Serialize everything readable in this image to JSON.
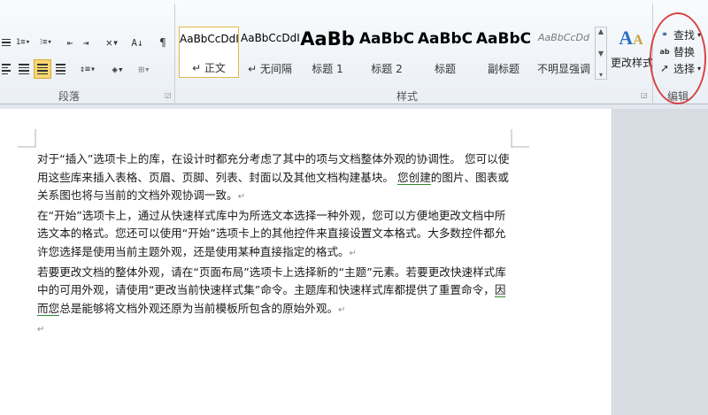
{
  "paragraph_group": {
    "label": "段落",
    "icons": [
      "bullets-icon",
      "numbering-icon",
      "multilevel-list-icon",
      "decrease-indent-icon",
      "increase-indent-icon",
      "chinese-layout-icon",
      "sort-icon",
      "show-marks-icon",
      "align-left-icon",
      "align-center-icon",
      "justify-icon",
      "distributed-icon",
      "line-spacing-icon",
      "shading-icon",
      "borders-icon"
    ]
  },
  "styles_group": {
    "label": "样式",
    "gallery": [
      {
        "sample": "AaBbCcDdI",
        "name": "↵ 正文",
        "selected": true
      },
      {
        "sample": "AaBbCcDdI",
        "name": "↵ 无间隔",
        "selected": false
      },
      {
        "sample": "AaBb",
        "name": "标题 1",
        "selected": false
      },
      {
        "sample": "AaBbC",
        "name": "标题 2",
        "selected": false
      },
      {
        "sample": "AaBbC",
        "name": "标题",
        "selected": false
      },
      {
        "sample": "AaBbC",
        "name": "副标题",
        "selected": false
      },
      {
        "sample": "AaBbCcDd",
        "name": "不明显强调",
        "selected": false
      }
    ],
    "change_styles_label": "更改样式"
  },
  "editing_group": {
    "label": "编辑",
    "find_label": "查找",
    "replace_label": "替换",
    "select_label": "选择"
  },
  "document": {
    "para1": {
      "text_before": "对于“插入”选项卡上的库，在设计时都充分考虑了其中的项与文档整体外观的协调性。 您可以使用这些库来插入表格、页眉、页脚、列表、封面以及其他文档构建基块。 ",
      "underlined": "您创建",
      "text_after": "的图片、图表或关系图也将与当前的文档外观协调一致。"
    },
    "para2": "在“开始”选项卡上，通过从快速样式库中为所选文本选择一种外观，您可以方便地更改文档中所选文本的格式。您还可以使用“开始”选项卡上的其他控件来直接设置文本格式。大多数控件都允许您选择是使用当前主题外观，还是使用某种直接指定的格式。",
    "para3": {
      "text_before": "若要更改文档的整体外观，请在“页面布局”选项卡上选择新的“主题”元素。若要更改快速样式库中的可用外观，请使用“更改当前快速样式集”命令。主题库和快速样式库都提供了重置命令，",
      "underlined": "因而您",
      "text_after": "总是能够将文档外观还原为当前模板所包含的原始外观。"
    },
    "paragraph_mark": "↵"
  },
  "colors": {
    "accent_selected": "#f7d770",
    "highlight_ellipse": "#d64545",
    "underline_green": "#2e8a2e"
  }
}
